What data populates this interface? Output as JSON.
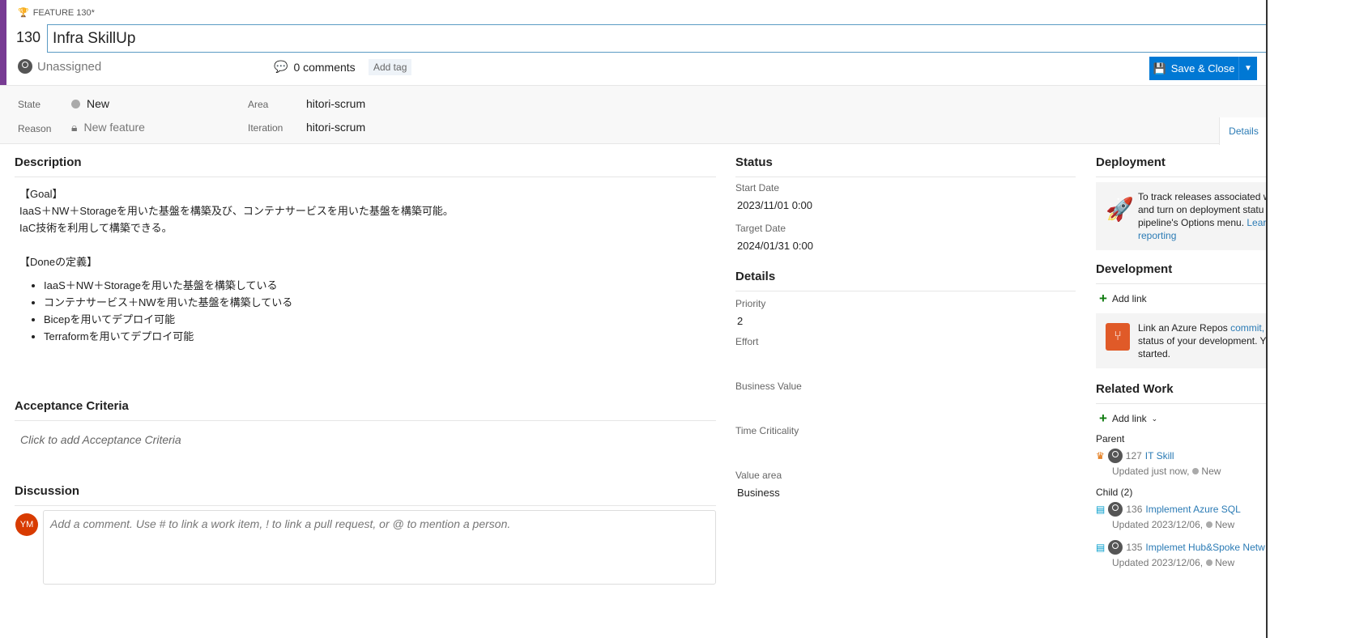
{
  "header": {
    "type_label": "FEATURE 130*",
    "id": "130",
    "title": "Infra SkillUp",
    "assignee": "Unassigned",
    "comments": "0 comments",
    "add_tag": "Add tag",
    "save_close": "Save & Close"
  },
  "fields": {
    "state_label": "State",
    "state": "New",
    "reason_label": "Reason",
    "reason": "New feature",
    "area_label": "Area",
    "area": "hitori-scrum",
    "iteration_label": "Iteration",
    "iteration": "hitori-scrum"
  },
  "tabs": {
    "details": "Details"
  },
  "description": {
    "heading": "Description",
    "goal_title": "【Goal】",
    "goal_line1": "IaaS＋NW＋Storageを用いた基盤を構築及び、コンテナサービスを用いた基盤を構築可能。",
    "goal_line2": "IaC技術を利用して構築できる。",
    "done_title": "【Doneの定義】",
    "done_items": [
      "IaaS＋NW＋Storageを用いた基盤を構築している",
      "コンテナサービス＋NWを用いた基盤を構築している",
      "Bicepを用いてデプロイ可能",
      "Terraformを用いてデプロイ可能"
    ]
  },
  "acceptance": {
    "heading": "Acceptance Criteria",
    "placeholder": "Click to add Acceptance Criteria"
  },
  "discussion": {
    "heading": "Discussion",
    "avatar_initials": "YM",
    "placeholder": "Add a comment. Use # to link a work item, ! to link a pull request, or @ to mention a person."
  },
  "status": {
    "heading": "Status",
    "start_label": "Start Date",
    "start": "2023/11/01 0:00",
    "target_label": "Target Date",
    "target": "2024/01/31 0:00"
  },
  "details": {
    "heading": "Details",
    "priority_label": "Priority",
    "priority": "2",
    "effort_label": "Effort",
    "effort": "",
    "business_value_label": "Business Value",
    "time_criticality_label": "Time Criticality",
    "value_area_label": "Value area",
    "value_area": "Business"
  },
  "deployment": {
    "heading": "Deployment",
    "text1": "To track releases associated w",
    "text2": "and turn on deployment statu",
    "text3": "pipeline's Options menu. ",
    "link1": "Lear",
    "link2": "reporting"
  },
  "development": {
    "heading": "Development",
    "add_link": "Add link",
    "text1": "Link an Azure Repos ",
    "link1": "commit,",
    "text2": "status of your development. Y",
    "text3": "started."
  },
  "related": {
    "heading": "Related Work",
    "add_link": "Add link",
    "parent_label": "Parent",
    "parent": {
      "id": "127",
      "title": "IT Skill",
      "updated": "Updated just now,",
      "state": "New"
    },
    "child_label": "Child (2)",
    "children": [
      {
        "id": "136",
        "title": "Implement Azure SQL",
        "updated": "Updated 2023/12/06,",
        "state": "New"
      },
      {
        "id": "135",
        "title": "Implemet Hub&Spoke Netw",
        "updated": "Updated 2023/12/06,",
        "state": "New"
      }
    ]
  },
  "colors": {
    "accent": "#0078d4",
    "feature": "#773b93",
    "epic": "#e06c00",
    "task": "#009ccc",
    "avatar": "#d83b01"
  }
}
